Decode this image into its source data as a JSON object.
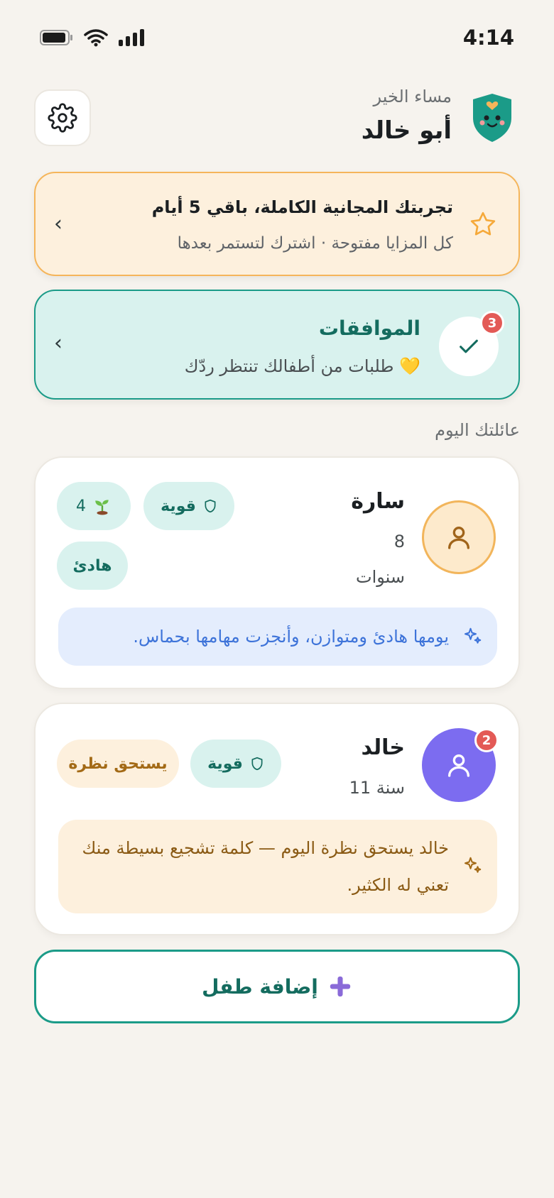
{
  "status_bar": {
    "time": "4:14"
  },
  "header": {
    "greeting": "مساء الخير",
    "name": "أبو خالد"
  },
  "trial": {
    "title": "تجربتك المجانية الكاملة، باقي 5 أيام",
    "subtitle": "كل المزايا مفتوحة · اشترك لتستمر بعدها"
  },
  "approvals": {
    "title": "الموافقات",
    "subtitle": "طلبات من أطفالك تنتظر ردّك 💛",
    "badge": "3"
  },
  "section_label": "عائلتك اليوم",
  "children": [
    {
      "name": "سارة",
      "age_number": "8",
      "age_unit": "سنوات",
      "chips": {
        "strength": "قوية",
        "plants": "4",
        "mood": "هادئ"
      },
      "note": "يومها هادئ ومتوازن، وأنجزت مهامها بحماس."
    },
    {
      "name": "خالد",
      "age": "11 سنة",
      "badge": "2",
      "chips": {
        "strength": "قوية",
        "attention": "يستحق نظرة"
      },
      "note": "خالد يستحق نظرة اليوم — كلمة تشجيع بسيطة منك تعني له الكثير."
    }
  ],
  "add_child": {
    "label": "إضافة طفل"
  },
  "icons": {
    "settings": "gear-icon",
    "star": "star-icon",
    "check": "check-icon",
    "chevron": "chevron-left-icon",
    "sparkle": "sparkle-icon",
    "shield": "shield-icon",
    "sprout": "sprout-icon",
    "plus": "plus-icon",
    "user": "user-icon"
  },
  "colors": {
    "background": "#f6f3ee",
    "teal": "#1b9b88",
    "teal_light": "#d9f2ee",
    "orange": "#f5b55a",
    "peach": "#fdf0dd",
    "purple": "#7c6cf0",
    "red_badge": "#e35a56",
    "blue_note": "#e4edfd"
  }
}
